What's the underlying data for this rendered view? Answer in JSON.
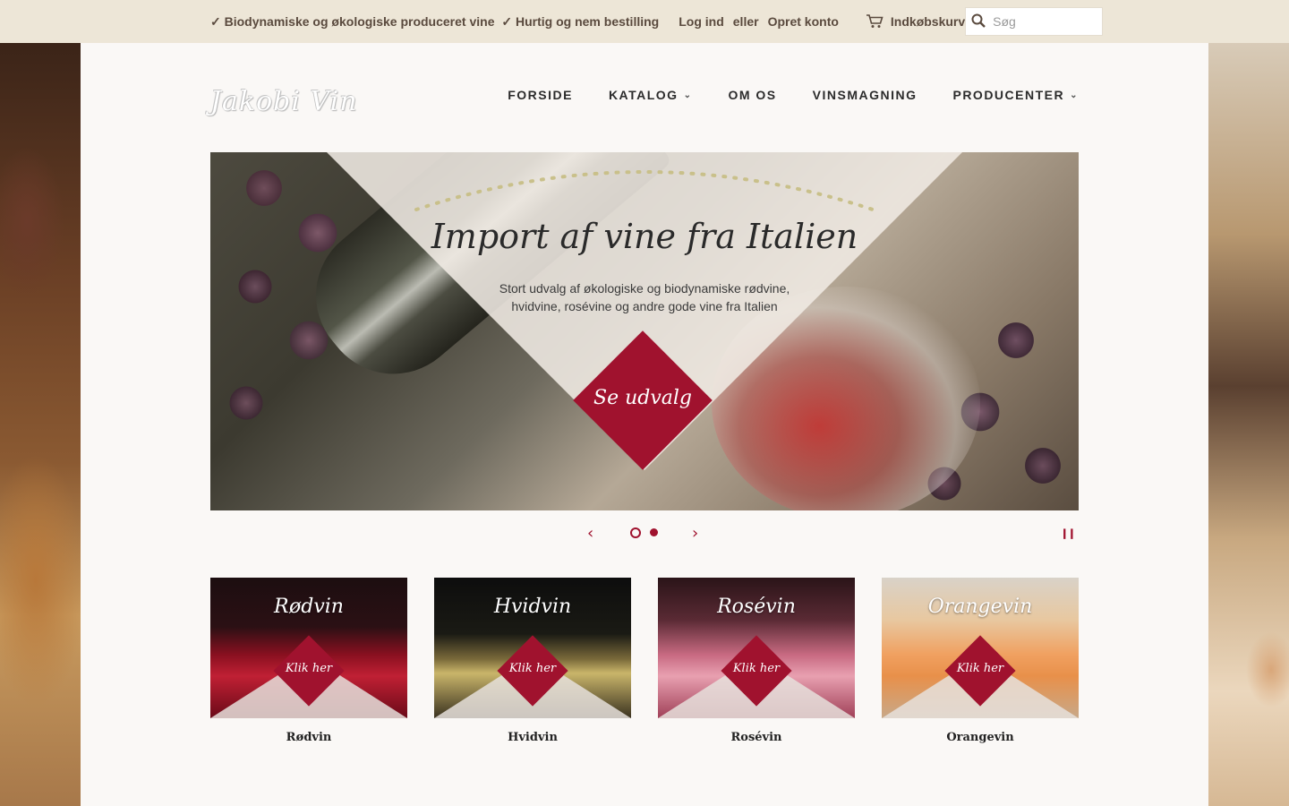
{
  "topbar": {
    "promo_1": "✓ Biodynamiske og økologiske produceret vine",
    "promo_2": "✓ Hurtig og nem bestilling",
    "login": "Log ind",
    "or": "eller",
    "create_account": "Opret konto",
    "cart": "Indkøbskurv",
    "search_placeholder": "Søg"
  },
  "logo": "Jakobi Vin",
  "nav": {
    "items": [
      {
        "label": "FORSIDE",
        "has_dropdown": false
      },
      {
        "label": "KATALOG",
        "has_dropdown": true
      },
      {
        "label": "OM OS",
        "has_dropdown": false
      },
      {
        "label": "VINSMAGNING",
        "has_dropdown": false
      },
      {
        "label": "PRODUCENTER",
        "has_dropdown": true
      }
    ]
  },
  "hero": {
    "title": "Import af vine fra Italien",
    "subtitle": "Stort udvalg af økologiske og biodynamiske rødvine, hvidvine, rosévine og andre gode vine fra Italien",
    "cta": "Se udvalg",
    "slides_total": 2,
    "active_slide": 1
  },
  "slider": {
    "prev_icon": "chevron-left-icon",
    "next_icon": "chevron-right-icon",
    "pause_icon": "pause-icon"
  },
  "categories": [
    {
      "name": "Rødvin",
      "cta": "Klik her",
      "caption": "Rødvin"
    },
    {
      "name": "Hvidvin",
      "cta": "Klik her",
      "caption": "Hvidvin"
    },
    {
      "name": "Rosévin",
      "cta": "Klik her",
      "caption": "Rosévin"
    },
    {
      "name": "Orangevin",
      "cta": "Klik her",
      "caption": "Orangevin"
    }
  ],
  "colors": {
    "accent": "#a0122e",
    "topbar_bg": "#ede6d7",
    "panel_bg": "#faf8f6"
  }
}
